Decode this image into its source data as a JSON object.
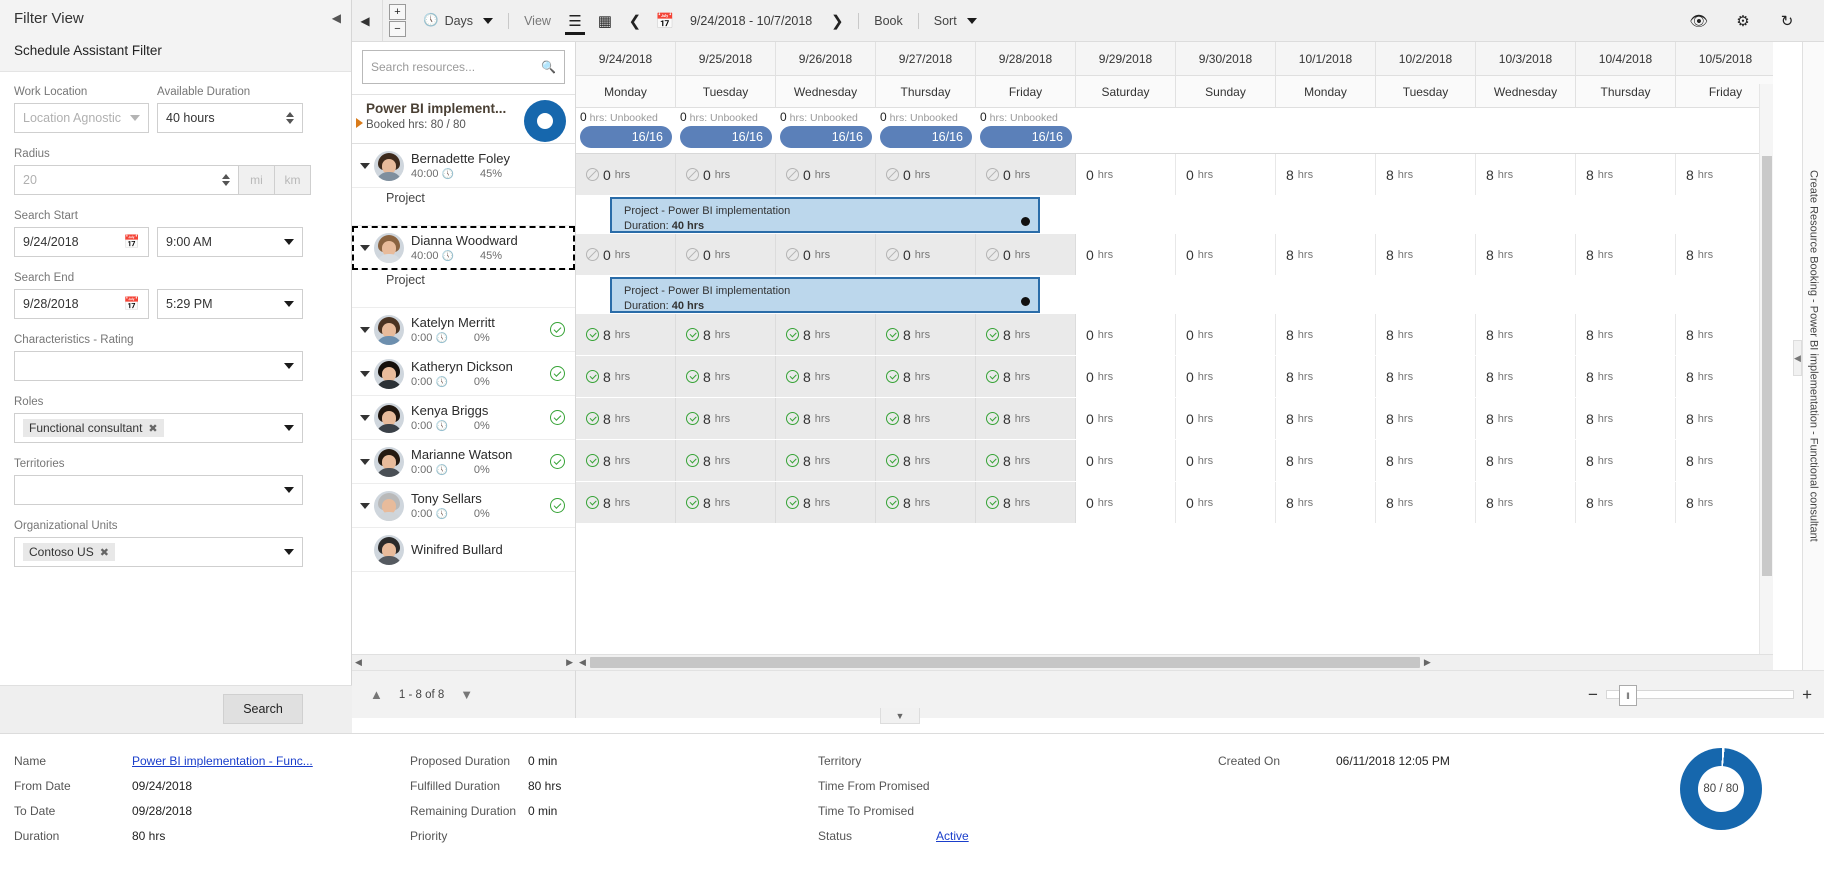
{
  "filter": {
    "view_title": "Filter View",
    "subtitle": "Schedule Assistant Filter",
    "collapse_icon": "chevron-left-icon",
    "work_location": {
      "label": "Work Location",
      "value": "Location Agnostic"
    },
    "available_duration": {
      "label": "Available Duration",
      "value": "40 hours"
    },
    "radius": {
      "label": "Radius",
      "value": "20",
      "unit_mi": "mi",
      "unit_km": "km"
    },
    "search_start": {
      "label": "Search Start",
      "date": "9/24/2018",
      "time": "9:00 AM"
    },
    "search_end": {
      "label": "Search End",
      "date": "9/28/2018",
      "time": "5:29 PM"
    },
    "characteristics": {
      "label": "Characteristics - Rating",
      "value": ""
    },
    "roles": {
      "label": "Roles",
      "chip": "Functional consultant"
    },
    "territories": {
      "label": "Territories",
      "value": ""
    },
    "org_units": {
      "label": "Organizational Units",
      "chip": "Contoso US"
    },
    "search_button": "Search"
  },
  "toolbar": {
    "back_arrow": "chevron-left-icon",
    "zoom_in": "+",
    "zoom_out": "−",
    "clock_label": "Days",
    "view_label": "View",
    "date_range": "9/24/2018 - 10/7/2018",
    "book_label": "Book",
    "sort_label": "Sort",
    "right_icons": [
      "eye-icon",
      "gear-icon",
      "refresh-icon"
    ]
  },
  "resources": {
    "search_placeholder": "Search resources...",
    "requirement": {
      "title": "Power BI implement...",
      "booked": "Booked hrs: 80 / 80"
    },
    "rows": [
      {
        "type": "person",
        "name": "Bernadette Foley",
        "hours": "40:00",
        "pct": "45%",
        "check": false,
        "selected": false,
        "hair": "#3d2a1c",
        "body": "#7f8f9e"
      },
      {
        "type": "project",
        "label": "Project"
      },
      {
        "type": "person",
        "name": "Dianna Woodward",
        "hours": "40:00",
        "pct": "45%",
        "check": false,
        "selected": true,
        "hair": "#8a6340",
        "body": "#d8dde2"
      },
      {
        "type": "project",
        "label": "Project"
      },
      {
        "type": "person",
        "name": "Katelyn Merritt",
        "hours": "0:00",
        "pct": "0%",
        "check": true,
        "selected": false,
        "hair": "#4a3322",
        "body": "#6d8fae"
      },
      {
        "type": "person",
        "name": "Katheryn Dickson",
        "hours": "0:00",
        "pct": "0%",
        "check": true,
        "selected": false,
        "hair": "#15100c",
        "body": "#2c3136"
      },
      {
        "type": "person",
        "name": "Kenya Briggs",
        "hours": "0:00",
        "pct": "0%",
        "check": true,
        "selected": false,
        "hair": "#20160f",
        "body": "#3b4148"
      },
      {
        "type": "person",
        "name": "Marianne Watson",
        "hours": "0:00",
        "pct": "0%",
        "check": true,
        "selected": false,
        "hair": "#241a12",
        "body": "#4a4f55"
      },
      {
        "type": "person",
        "name": "Tony Sellars",
        "hours": "0:00",
        "pct": "0%",
        "check": true,
        "selected": false,
        "hair": "#b9b9b9",
        "body": "#cfd4d8"
      },
      {
        "type": "person",
        "name": "Winifred Bullard",
        "hours": "",
        "pct": "",
        "check": false,
        "selected": false,
        "hair": "#2a2a2a",
        "body": "#555a60"
      }
    ],
    "pager": {
      "range": "1 - 8 of 8",
      "up_icon": "chevron-up-icon",
      "down_icon": "chevron-down-icon"
    }
  },
  "schedule": {
    "columns": [
      {
        "date": "9/24/2018",
        "day": "Monday",
        "unbooked": "0 hrs: Unbooked",
        "pill": "16/16"
      },
      {
        "date": "9/25/2018",
        "day": "Tuesday",
        "unbooked": "0 hrs: Unbooked",
        "pill": "16/16"
      },
      {
        "date": "9/26/2018",
        "day": "Wednesday",
        "unbooked": "0 hrs: Unbooked",
        "pill": "16/16"
      },
      {
        "date": "9/27/2018",
        "day": "Thursday",
        "unbooked": "0 hrs: Unbooked",
        "pill": "16/16"
      },
      {
        "date": "9/28/2018",
        "day": "Friday",
        "unbooked": "0 hrs: Unbooked",
        "pill": "16/16"
      },
      {
        "date": "9/29/2018",
        "day": "Saturday",
        "unbooked": "",
        "pill": ""
      },
      {
        "date": "9/30/2018",
        "day": "Sunday",
        "unbooked": "",
        "pill": ""
      },
      {
        "date": "10/1/2018",
        "day": "Monday",
        "unbooked": "",
        "pill": ""
      },
      {
        "date": "10/2/2018",
        "day": "Tuesday",
        "unbooked": "",
        "pill": ""
      },
      {
        "date": "10/3/2018",
        "day": "Wednesday",
        "unbooked": "",
        "pill": ""
      },
      {
        "date": "10/4/2018",
        "day": "Thursday",
        "unbooked": "",
        "pill": ""
      },
      {
        "date": "10/5/2018",
        "day": "Friday",
        "unbooked": "",
        "pill": ""
      }
    ],
    "rows": [
      {
        "kind": "hours",
        "cells": [
          {
            "v": "0",
            "u": "hrs",
            "icon": "blocked",
            "shaded": true
          },
          {
            "v": "0",
            "u": "hrs",
            "icon": "blocked",
            "shaded": true
          },
          {
            "v": "0",
            "u": "hrs",
            "icon": "blocked",
            "shaded": true
          },
          {
            "v": "0",
            "u": "hrs",
            "icon": "blocked",
            "shaded": true
          },
          {
            "v": "0",
            "u": "hrs",
            "icon": "blocked",
            "shaded": true
          },
          {
            "v": "0",
            "u": "hrs",
            "icon": "none",
            "shaded": false
          },
          {
            "v": "0",
            "u": "hrs",
            "icon": "none",
            "shaded": false
          },
          {
            "v": "8",
            "u": "hrs",
            "icon": "none",
            "shaded": false
          },
          {
            "v": "8",
            "u": "hrs",
            "icon": "none",
            "shaded": false
          },
          {
            "v": "8",
            "u": "hrs",
            "icon": "none",
            "shaded": false
          },
          {
            "v": "8",
            "u": "hrs",
            "icon": "none",
            "shaded": false
          },
          {
            "v": "8",
            "u": "hrs",
            "icon": "none",
            "shaded": false
          }
        ]
      },
      {
        "kind": "booking",
        "title": "Project - Power BI implementation",
        "duration_label": "Duration:",
        "duration": "40 hrs"
      },
      {
        "kind": "hours",
        "cells": [
          {
            "v": "0",
            "u": "hrs",
            "icon": "blocked",
            "shaded": true
          },
          {
            "v": "0",
            "u": "hrs",
            "icon": "blocked",
            "shaded": true
          },
          {
            "v": "0",
            "u": "hrs",
            "icon": "blocked",
            "shaded": true
          },
          {
            "v": "0",
            "u": "hrs",
            "icon": "blocked",
            "shaded": true
          },
          {
            "v": "0",
            "u": "hrs",
            "icon": "blocked",
            "shaded": true
          },
          {
            "v": "0",
            "u": "hrs",
            "icon": "none",
            "shaded": false
          },
          {
            "v": "0",
            "u": "hrs",
            "icon": "none",
            "shaded": false
          },
          {
            "v": "8",
            "u": "hrs",
            "icon": "none",
            "shaded": false
          },
          {
            "v": "8",
            "u": "hrs",
            "icon": "none",
            "shaded": false
          },
          {
            "v": "8",
            "u": "hrs",
            "icon": "none",
            "shaded": false
          },
          {
            "v": "8",
            "u": "hrs",
            "icon": "none",
            "shaded": false
          },
          {
            "v": "8",
            "u": "hrs",
            "icon": "none",
            "shaded": false
          }
        ]
      },
      {
        "kind": "booking",
        "title": "Project - Power BI implementation",
        "duration_label": "Duration:",
        "duration": "40 hrs"
      },
      {
        "kind": "hours",
        "cells": [
          {
            "v": "8",
            "u": "hrs",
            "icon": "check",
            "shaded": true
          },
          {
            "v": "8",
            "u": "hrs",
            "icon": "check",
            "shaded": true
          },
          {
            "v": "8",
            "u": "hrs",
            "icon": "check",
            "shaded": true
          },
          {
            "v": "8",
            "u": "hrs",
            "icon": "check",
            "shaded": true
          },
          {
            "v": "8",
            "u": "hrs",
            "icon": "check",
            "shaded": true
          },
          {
            "v": "0",
            "u": "hrs",
            "icon": "none",
            "shaded": false
          },
          {
            "v": "0",
            "u": "hrs",
            "icon": "none",
            "shaded": false
          },
          {
            "v": "8",
            "u": "hrs",
            "icon": "none",
            "shaded": false
          },
          {
            "v": "8",
            "u": "hrs",
            "icon": "none",
            "shaded": false
          },
          {
            "v": "8",
            "u": "hrs",
            "icon": "none",
            "shaded": false
          },
          {
            "v": "8",
            "u": "hrs",
            "icon": "none",
            "shaded": false
          },
          {
            "v": "8",
            "u": "hrs",
            "icon": "none",
            "shaded": false
          }
        ]
      },
      {
        "kind": "hours",
        "cells": [
          {
            "v": "8",
            "u": "hrs",
            "icon": "check",
            "shaded": true
          },
          {
            "v": "8",
            "u": "hrs",
            "icon": "check",
            "shaded": true
          },
          {
            "v": "8",
            "u": "hrs",
            "icon": "check",
            "shaded": true
          },
          {
            "v": "8",
            "u": "hrs",
            "icon": "check",
            "shaded": true
          },
          {
            "v": "8",
            "u": "hrs",
            "icon": "check",
            "shaded": true
          },
          {
            "v": "0",
            "u": "hrs",
            "icon": "none",
            "shaded": false
          },
          {
            "v": "0",
            "u": "hrs",
            "icon": "none",
            "shaded": false
          },
          {
            "v": "8",
            "u": "hrs",
            "icon": "none",
            "shaded": false
          },
          {
            "v": "8",
            "u": "hrs",
            "icon": "none",
            "shaded": false
          },
          {
            "v": "8",
            "u": "hrs",
            "icon": "none",
            "shaded": false
          },
          {
            "v": "8",
            "u": "hrs",
            "icon": "none",
            "shaded": false
          },
          {
            "v": "8",
            "u": "hrs",
            "icon": "none",
            "shaded": false
          }
        ]
      },
      {
        "kind": "hours",
        "cells": [
          {
            "v": "8",
            "u": "hrs",
            "icon": "check",
            "shaded": true
          },
          {
            "v": "8",
            "u": "hrs",
            "icon": "check",
            "shaded": true
          },
          {
            "v": "8",
            "u": "hrs",
            "icon": "check",
            "shaded": true
          },
          {
            "v": "8",
            "u": "hrs",
            "icon": "check",
            "shaded": true
          },
          {
            "v": "8",
            "u": "hrs",
            "icon": "check",
            "shaded": true
          },
          {
            "v": "0",
            "u": "hrs",
            "icon": "none",
            "shaded": false
          },
          {
            "v": "0",
            "u": "hrs",
            "icon": "none",
            "shaded": false
          },
          {
            "v": "8",
            "u": "hrs",
            "icon": "none",
            "shaded": false
          },
          {
            "v": "8",
            "u": "hrs",
            "icon": "none",
            "shaded": false
          },
          {
            "v": "8",
            "u": "hrs",
            "icon": "none",
            "shaded": false
          },
          {
            "v": "8",
            "u": "hrs",
            "icon": "none",
            "shaded": false
          },
          {
            "v": "8",
            "u": "hrs",
            "icon": "none",
            "shaded": false
          }
        ]
      },
      {
        "kind": "hours",
        "cells": [
          {
            "v": "8",
            "u": "hrs",
            "icon": "check",
            "shaded": true
          },
          {
            "v": "8",
            "u": "hrs",
            "icon": "check",
            "shaded": true
          },
          {
            "v": "8",
            "u": "hrs",
            "icon": "check",
            "shaded": true
          },
          {
            "v": "8",
            "u": "hrs",
            "icon": "check",
            "shaded": true
          },
          {
            "v": "8",
            "u": "hrs",
            "icon": "check",
            "shaded": true
          },
          {
            "v": "0",
            "u": "hrs",
            "icon": "none",
            "shaded": false
          },
          {
            "v": "0",
            "u": "hrs",
            "icon": "none",
            "shaded": false
          },
          {
            "v": "8",
            "u": "hrs",
            "icon": "none",
            "shaded": false
          },
          {
            "v": "8",
            "u": "hrs",
            "icon": "none",
            "shaded": false
          },
          {
            "v": "8",
            "u": "hrs",
            "icon": "none",
            "shaded": false
          },
          {
            "v": "8",
            "u": "hrs",
            "icon": "none",
            "shaded": false
          },
          {
            "v": "8",
            "u": "hrs",
            "icon": "none",
            "shaded": false
          }
        ]
      },
      {
        "kind": "hours",
        "cells": [
          {
            "v": "8",
            "u": "hrs",
            "icon": "check",
            "shaded": true
          },
          {
            "v": "8",
            "u": "hrs",
            "icon": "check",
            "shaded": true
          },
          {
            "v": "8",
            "u": "hrs",
            "icon": "check",
            "shaded": true
          },
          {
            "v": "8",
            "u": "hrs",
            "icon": "check",
            "shaded": true
          },
          {
            "v": "8",
            "u": "hrs",
            "icon": "check",
            "shaded": true
          },
          {
            "v": "0",
            "u": "hrs",
            "icon": "none",
            "shaded": false
          },
          {
            "v": "0",
            "u": "hrs",
            "icon": "none",
            "shaded": false
          },
          {
            "v": "8",
            "u": "hrs",
            "icon": "none",
            "shaded": false
          },
          {
            "v": "8",
            "u": "hrs",
            "icon": "none",
            "shaded": false
          },
          {
            "v": "8",
            "u": "hrs",
            "icon": "none",
            "shaded": false
          },
          {
            "v": "8",
            "u": "hrs",
            "icon": "none",
            "shaded": false
          },
          {
            "v": "8",
            "u": "hrs",
            "icon": "none",
            "shaded": false
          }
        ]
      }
    ],
    "zoom": {
      "minus": "−",
      "plus": "+",
      "thumb": "‖"
    }
  },
  "side_tab": {
    "label": "Create Resource Booking - Power BI implementation - Functional consultant"
  },
  "detail": {
    "col1": [
      {
        "key": "Name",
        "value": "Power BI implementation - Func...",
        "link": true
      },
      {
        "key": "From Date",
        "value": "09/24/2018",
        "link": false
      },
      {
        "key": "To Date",
        "value": "09/28/2018",
        "link": false
      },
      {
        "key": "Duration",
        "value": "80 hrs",
        "link": false
      }
    ],
    "col2": [
      {
        "key": "Proposed Duration",
        "value": "0 min",
        "link": false
      },
      {
        "key": "Fulfilled Duration",
        "value": "80 hrs",
        "link": false
      },
      {
        "key": "Remaining Duration",
        "value": "0 min",
        "link": false
      },
      {
        "key": "Priority",
        "value": "",
        "link": false
      }
    ],
    "col3": [
      {
        "key": "Territory",
        "value": "",
        "link": false
      },
      {
        "key": "Time From Promised",
        "value": "",
        "link": false
      },
      {
        "key": "Time To Promised",
        "value": "",
        "link": false
      },
      {
        "key": "Status",
        "value": "Active",
        "link": true
      }
    ],
    "col4": [
      {
        "key": "Created On",
        "value": "06/11/2018 12:05 PM",
        "link": false
      }
    ],
    "donut": "80 / 80"
  }
}
